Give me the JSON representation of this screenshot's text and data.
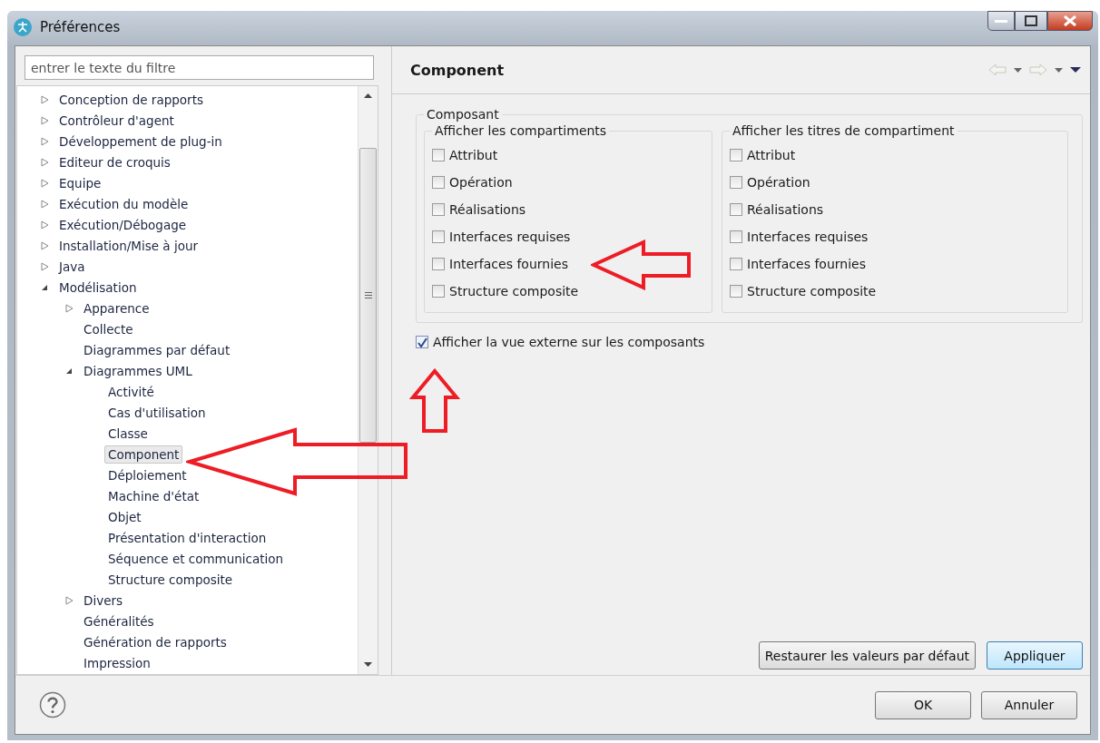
{
  "window": {
    "title": "Préférences"
  },
  "filter": {
    "placeholder": "entrer le texte du filtre"
  },
  "tree": [
    {
      "label": "Conception de rapports",
      "expanded": false,
      "selected": false
    },
    {
      "label": "Contrôleur d'agent",
      "expanded": false,
      "selected": false
    },
    {
      "label": "Développement de plug-in",
      "expanded": false,
      "selected": false
    },
    {
      "label": "Editeur de croquis",
      "expanded": false,
      "selected": false
    },
    {
      "label": "Equipe",
      "expanded": false,
      "selected": false
    },
    {
      "label": "Exécution du modèle",
      "expanded": false,
      "selected": false
    },
    {
      "label": "Exécution/Débogage",
      "expanded": false,
      "selected": false
    },
    {
      "label": "Installation/Mise à jour",
      "expanded": false,
      "selected": false
    },
    {
      "label": "Java",
      "expanded": false,
      "selected": false
    },
    {
      "label": "Modélisation",
      "expanded": true,
      "selected": false,
      "children": [
        {
          "label": "Apparence",
          "expanded": false,
          "selected": false
        },
        {
          "label": "Collecte",
          "selected": false
        },
        {
          "label": "Diagrammes par défaut",
          "selected": false
        },
        {
          "label": "Diagrammes UML",
          "expanded": true,
          "selected": false,
          "children": [
            {
              "label": "Activité",
              "selected": false
            },
            {
              "label": "Cas d'utilisation",
              "selected": false
            },
            {
              "label": "Classe",
              "selected": false
            },
            {
              "label": "Component",
              "selected": true
            },
            {
              "label": "Déploiement",
              "selected": false
            },
            {
              "label": "Machine d'état",
              "selected": false
            },
            {
              "label": "Objet",
              "selected": false
            },
            {
              "label": "Présentation d'interaction",
              "selected": false
            },
            {
              "label": "Séquence et communication",
              "selected": false
            },
            {
              "label": "Structure composite",
              "selected": false
            }
          ]
        },
        {
          "label": "Divers",
          "expanded": false,
          "selected": false
        },
        {
          "label": "Généralités",
          "selected": false
        },
        {
          "label": "Génération de rapports",
          "selected": false
        },
        {
          "label": "Impression",
          "selected": false
        }
      ]
    }
  ],
  "page": {
    "title": "Component",
    "group": {
      "title": "Composant",
      "subgroups": [
        {
          "title": "Afficher les compartiments",
          "options": [
            {
              "label": "Attribut",
              "checked": false
            },
            {
              "label": "Opération",
              "checked": false
            },
            {
              "label": "Réalisations",
              "checked": false
            },
            {
              "label": "Interfaces requises",
              "checked": false
            },
            {
              "label": "Interfaces fournies",
              "checked": false
            },
            {
              "label": "Structure composite",
              "checked": false
            }
          ]
        },
        {
          "title": "Afficher les titres de compartiment",
          "options": [
            {
              "label": "Attribut",
              "checked": false
            },
            {
              "label": "Opération",
              "checked": false
            },
            {
              "label": "Réalisations",
              "checked": false
            },
            {
              "label": "Interfaces requises",
              "checked": false
            },
            {
              "label": "Interfaces fournies",
              "checked": false
            },
            {
              "label": "Structure composite",
              "checked": false
            }
          ]
        }
      ]
    },
    "external_view": {
      "label": "Afficher la vue externe sur les composants",
      "checked": true
    },
    "buttons": [
      "Restaurer les valeurs par défaut",
      "Appliquer"
    ]
  },
  "dialog_buttons": [
    "OK",
    "Annuler"
  ]
}
